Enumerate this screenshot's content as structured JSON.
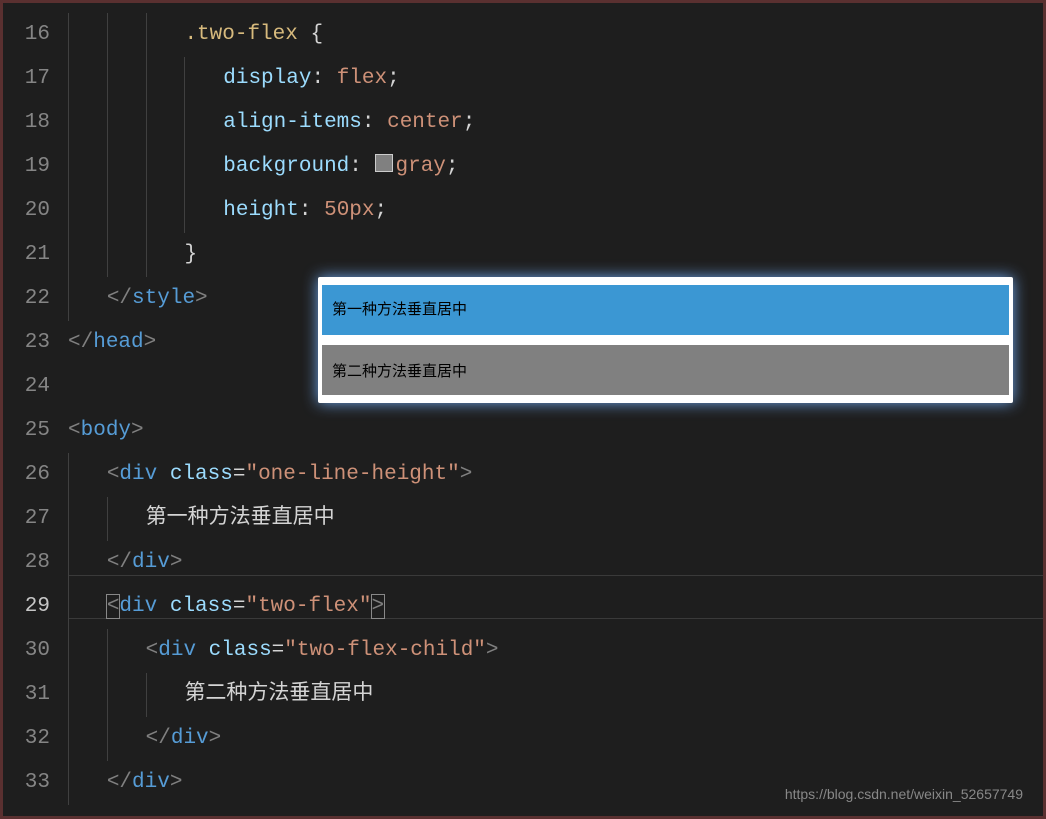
{
  "line_numbers": [
    "16",
    "17",
    "18",
    "19",
    "20",
    "21",
    "22",
    "23",
    "24",
    "25",
    "26",
    "27",
    "28",
    "29",
    "30",
    "31",
    "32",
    "33"
  ],
  "code": {
    "l16": {
      "selector": ".two-flex",
      "brace_open": " {"
    },
    "l17": {
      "prop": "display",
      "val": "flex"
    },
    "l18": {
      "prop": "align-items",
      "val": "center"
    },
    "l19": {
      "prop": "background",
      "val": "gray"
    },
    "l20": {
      "prop": "height",
      "val": "50px"
    },
    "l21": {
      "brace_close": "}"
    },
    "l22": {
      "close_tag": "style"
    },
    "l23": {
      "close_tag": "head"
    },
    "l25": {
      "open_tag": "body"
    },
    "l26": {
      "open_tag": "div",
      "attr": "class",
      "attr_val": "\"one-line-height\""
    },
    "l27": {
      "text": "第一种方法垂直居中"
    },
    "l28": {
      "close_tag": "div"
    },
    "l29": {
      "open_tag": "div",
      "attr": "class",
      "attr_val": "\"two-flex\""
    },
    "l30": {
      "open_tag": "div",
      "attr": "class",
      "attr_val": "\"two-flex-child\""
    },
    "l31": {
      "text": "第二种方法垂直居中"
    },
    "l32": {
      "close_tag": "div"
    },
    "l33": {
      "close_tag": "div"
    }
  },
  "preview": {
    "row1": "第一种方法垂直居中",
    "row2": "第二种方法垂直居中"
  },
  "watermark": "https://blog.csdn.net/weixin_52657749"
}
